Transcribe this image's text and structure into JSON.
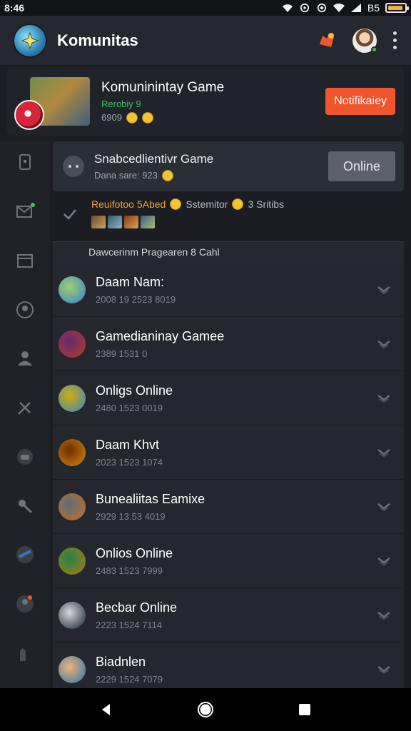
{
  "status_bar": {
    "time": "8:46",
    "carrier": "B5"
  },
  "app": {
    "title": "Komunitas"
  },
  "featured": {
    "title": "Komuninintay Game",
    "subtitle": "Rerobiy 9",
    "meta": "6909",
    "button_label": "Notifikaiey"
  },
  "status_card": {
    "title": "Snabcedlientivr Game",
    "meta": "Dana sare: 923",
    "button_label": "Online"
  },
  "activity": {
    "highlight": "Reuifotoo 5Abed",
    "rest": "Sstemitor",
    "tail": "3 Sritibs"
  },
  "section": {
    "header": "Dawcerinm Pragearen 8 Cahl"
  },
  "games": [
    {
      "title": "Daam Nam:",
      "meta": "2008 19 2523 8019",
      "colors": [
        "#3a7bd5",
        "#9bd36a"
      ]
    },
    {
      "title": "Gamedianinay Gamee",
      "meta": "2389 1531 0",
      "colors": [
        "#c0392b",
        "#5b2d6e"
      ]
    },
    {
      "title": "Onligs Online",
      "meta": "2480 1523 0019",
      "colors": [
        "#2e86c1",
        "#d4ac0d"
      ]
    },
    {
      "title": "Daam Khvt",
      "meta": "2023 1523 1074",
      "colors": [
        "#d68910",
        "#6e2c00"
      ]
    },
    {
      "title": "Bunealiitas Eamixe",
      "meta": "2929 13.53 4019",
      "colors": [
        "#ca6f1e",
        "#5d6d7e"
      ]
    },
    {
      "title": "Onlios Online",
      "meta": "2483 1523 7999",
      "colors": [
        "#b9770e",
        "#1e8449"
      ]
    },
    {
      "title": "Becbar Online",
      "meta": "2223 1524 7114",
      "colors": [
        "#17202a",
        "#d5d8dc"
      ]
    },
    {
      "title": "Biadnlen",
      "meta": "2229 1524 7079",
      "colors": [
        "#2874a6",
        "#f0b27a"
      ]
    }
  ],
  "rail_icons": [
    "bookmark-icon",
    "mail-icon",
    "calendar-icon",
    "target-icon",
    "person-icon",
    "tools-icon",
    "chat-icon",
    "pin-icon",
    "controller-icon",
    "person-alert-icon",
    "castle-icon"
  ],
  "colors": {
    "accent": "#f0562b",
    "online_green": "#39c45a",
    "background": "#1b1d22"
  }
}
